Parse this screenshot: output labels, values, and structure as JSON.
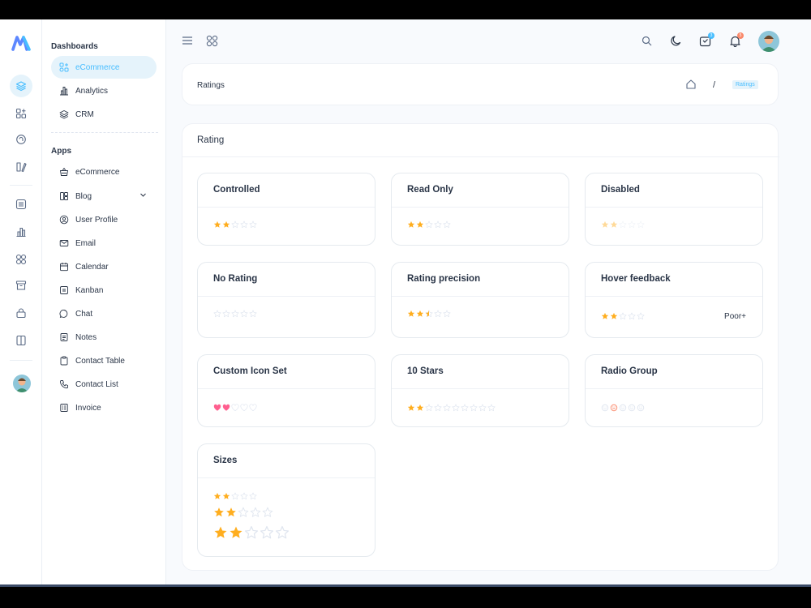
{
  "colors": {
    "accent": "#49beff",
    "star_filled": "#ffae1f",
    "star_empty": "#dfe5ef",
    "heart": "#ff5f8f",
    "badge_blue": "#49beff",
    "badge_red": "#fa896b"
  },
  "sidebar": {
    "dashboards_heading": "Dashboards",
    "apps_heading": "Apps",
    "dashboards": [
      {
        "label": "eCommerce",
        "icon": "grid-shapes-icon",
        "active": true
      },
      {
        "label": "Analytics",
        "icon": "chart-bar-icon"
      },
      {
        "label": "CRM",
        "icon": "layers-icon"
      }
    ],
    "apps": [
      {
        "label": "eCommerce",
        "icon": "basket-icon"
      },
      {
        "label": "Blog",
        "icon": "layout-icon",
        "has_chevron": true
      },
      {
        "label": "User Profile",
        "icon": "user-circle-icon"
      },
      {
        "label": "Email",
        "icon": "mail-icon"
      },
      {
        "label": "Calendar",
        "icon": "calendar-icon"
      },
      {
        "label": "Kanban",
        "icon": "kanban-icon"
      },
      {
        "label": "Chat",
        "icon": "chat-icon"
      },
      {
        "label": "Notes",
        "icon": "notes-icon"
      },
      {
        "label": "Contact Table",
        "icon": "clipboard-icon"
      },
      {
        "label": "Contact List",
        "icon": "phone-icon"
      },
      {
        "label": "Invoice",
        "icon": "invoice-icon"
      }
    ]
  },
  "topbar": {
    "cart_badge": "3",
    "notification_badge": "5"
  },
  "breadcrumb": {
    "title": "Ratings",
    "separator": "/",
    "current": "Ratings"
  },
  "main": {
    "title": "Rating",
    "cards": [
      {
        "title": "Controlled",
        "rating": 2,
        "max": 5,
        "style": "star"
      },
      {
        "title": "Read Only",
        "rating": 2,
        "max": 5,
        "style": "star"
      },
      {
        "title": "Disabled",
        "rating": 2,
        "max": 5,
        "style": "star-disabled"
      },
      {
        "title": "No Rating",
        "rating": 0,
        "max": 5,
        "style": "star"
      },
      {
        "title": "Rating precision",
        "rating": 2.5,
        "max": 5,
        "style": "star"
      },
      {
        "title": "Hover feedback",
        "rating": 2,
        "max": 5,
        "style": "star",
        "label": "Poor+"
      },
      {
        "title": "Custom Icon Set",
        "rating": 2,
        "max": 5,
        "style": "heart"
      },
      {
        "title": "10 Stars",
        "rating": 2,
        "max": 10,
        "style": "star"
      },
      {
        "title": "Radio Group",
        "rating": 2,
        "max": 5,
        "style": "face"
      },
      {
        "title": "Sizes",
        "rating": 2,
        "max": 5,
        "style": "sizes"
      }
    ]
  }
}
